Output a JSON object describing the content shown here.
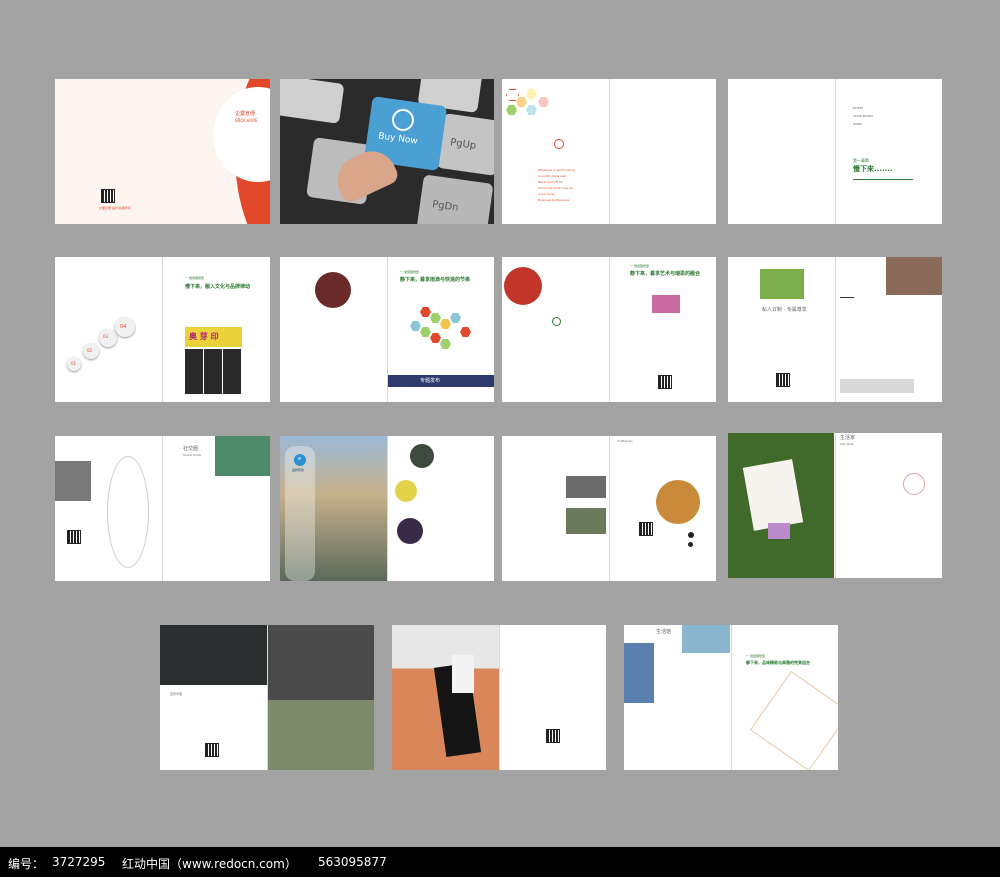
{
  "pages": {
    "cover": {
      "title": "企業宣傳",
      "subtitle": "BROCHURE",
      "footer": "企業宣傳 設計 版權所有"
    },
    "keyboard": {
      "key_label": "Buy Now",
      "key_pgup": "PgUp",
      "key_pgdn": "PgDn"
    },
    "hex_intro": {
      "lines": [
        "Whatever is worth doing",
        "is worth doing well",
        "Never put off till",
        "tomorrow what may be",
        "done today",
        "Business to Business"
      ]
    },
    "chapter1": {
      "label": "第一章節",
      "title": "慢下來.......",
      "notes": [
        "NOTES",
        "SLOW DOWN",
        "WORK"
      ]
    },
    "slow_culture": {
      "kicker": "一 慢慢理想型",
      "title": "慢下来，融入文化与品牌律动",
      "steps": [
        "01",
        "02",
        "03",
        "04"
      ],
      "sign": "奥 芽 印"
    },
    "quiet_time": {
      "kicker": "一 慢慢理想型",
      "title": "静下来，着享雨滴与快速的节奏",
      "band": "专题发布"
    },
    "quiet_art": {
      "kicker": "一 慢慢理想型",
      "title": "静下来，着享艺术与瑞思的融合"
    },
    "private_custom": {
      "title": "私人订制 · 专属尊享"
    },
    "community": {
      "heading": "社交圈",
      "sub": "Social circle"
    },
    "city": {
      "logo": "e",
      "brand": "品牌形象"
    },
    "crafts": {
      "header": "Craftsman"
    },
    "brochure_spread": {
      "caption": "宣传手册"
    },
    "lifestyle": {
      "heading": "生活家",
      "sub": "Life style"
    },
    "closing": {
      "kicker": "一 慢慢理想型",
      "title": "静下来，品味精致与典雅的完美组合",
      "heading": "生活馆"
    },
    "watermark": {
      "number_label": "编号：",
      "number": "3727295",
      "site": "红动中国（www.redocn.com）",
      "id": "563095877"
    },
    "colors": {
      "accent": "#e2492b",
      "green": "#2f7d32",
      "navy": "#2d3a6b",
      "background": "#a3a3a3"
    }
  }
}
